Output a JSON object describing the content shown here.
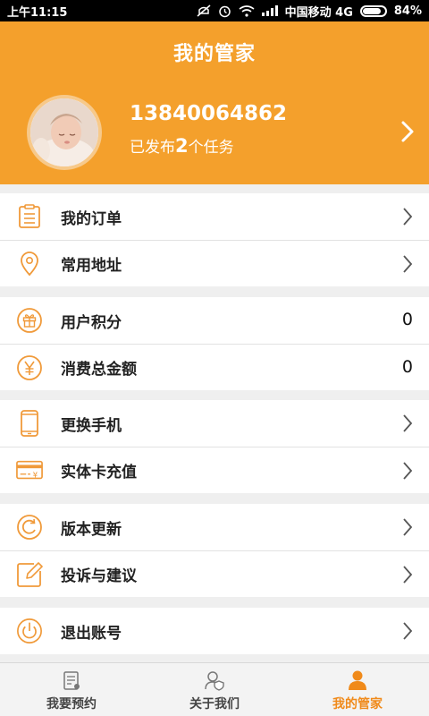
{
  "status_bar": {
    "time": "上午11:15",
    "carrier": "中国移动 4G",
    "battery": "84%",
    "battery_level": 0.84
  },
  "header": {
    "title": "我的管家",
    "phone": "13840064862",
    "tasks_prefix": "已发布",
    "tasks_count": "2",
    "tasks_suffix": "个任务"
  },
  "menu": {
    "orders": "我的订单",
    "address": "常用地址",
    "points": "用户积分",
    "points_value": "0",
    "spending": "消费总金额",
    "spending_value": "0",
    "change_phone": "更换手机",
    "card_recharge": "实体卡充值",
    "update": "版本更新",
    "feedback": "投诉与建议",
    "logout": "退出账号"
  },
  "tabs": {
    "booking": "我要预约",
    "about": "关于我们",
    "butler": "我的管家"
  },
  "colors": {
    "accent": "#f4a02c",
    "icon": "#f09a3a",
    "active_tab": "#f08a1a"
  }
}
